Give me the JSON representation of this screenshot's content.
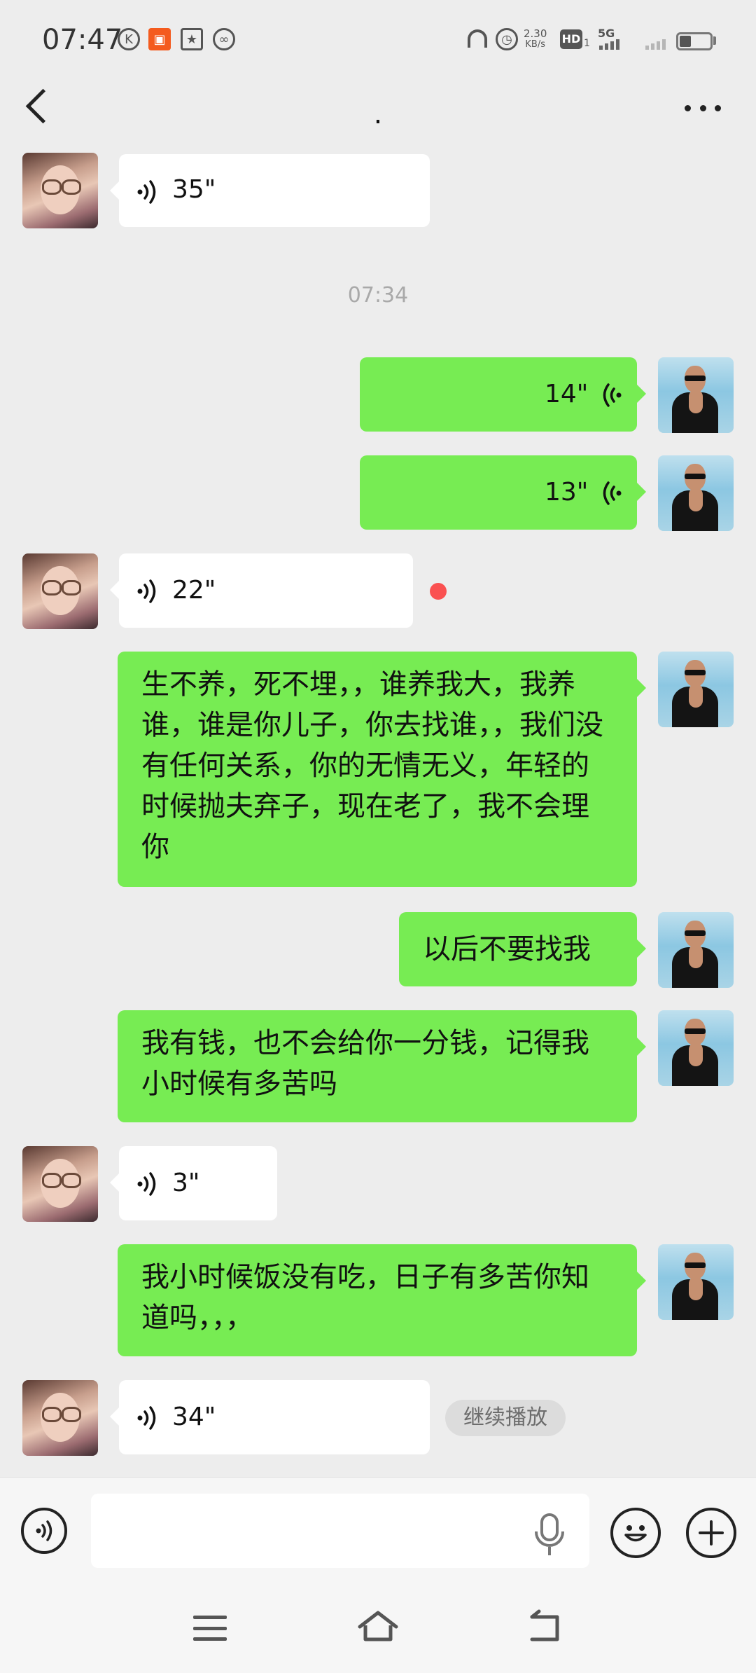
{
  "status_bar": {
    "time": "07:47",
    "speed_value": "2.30",
    "speed_unit": "KB/s",
    "hd_label": "HD",
    "hd_sub": "1",
    "network": "5G",
    "icons": [
      "k-icon",
      "kuaishou-icon",
      "star-message-icon",
      "link-icon",
      "headphones-icon",
      "alarm-icon",
      "battery-icon"
    ]
  },
  "nav": {
    "title": "."
  },
  "messages": [
    {
      "side": "left",
      "kind": "voice",
      "duration": "35\""
    },
    {
      "kind": "time",
      "text": "07:34"
    },
    {
      "side": "right",
      "kind": "voice",
      "duration": "14\""
    },
    {
      "side": "right",
      "kind": "voice",
      "duration": "13\""
    },
    {
      "side": "left",
      "kind": "voice",
      "duration": "22\"",
      "unread": true
    },
    {
      "side": "right",
      "kind": "text",
      "text": "生不养，死不埋，，谁养我大，我养谁，谁是你儿子，你去找谁，，我们没有任何关系，你的无情无义，年轻的时候抛夫弃子，现在老了，我不会理你"
    },
    {
      "side": "right",
      "kind": "text",
      "text": "以后不要找我"
    },
    {
      "side": "right",
      "kind": "text",
      "text": "我有钱，也不会给你一分钱，记得我小时候有多苦吗"
    },
    {
      "side": "left",
      "kind": "voice",
      "duration": "3\""
    },
    {
      "side": "right",
      "kind": "text",
      "text": "我小时候饭没有吃，日子有多苦你知道吗，，，"
    },
    {
      "side": "left",
      "kind": "voice",
      "duration": "34\"",
      "action": "继续播放"
    }
  ],
  "input_bar": {
    "placeholder": ""
  },
  "colors": {
    "background": "#ededed",
    "outgoing_bubble": "#77ec53",
    "incoming_bubble": "#ffffff",
    "unread_dot": "#fa5151"
  }
}
